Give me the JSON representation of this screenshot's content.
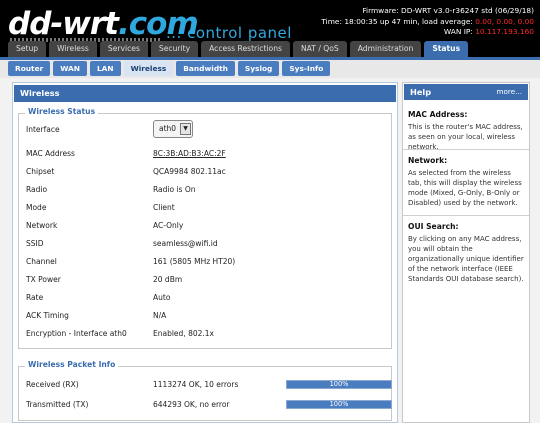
{
  "header": {
    "logo_main": "dd-wrt",
    "logo_dot": ".com",
    "logo_sub": "... control panel",
    "firmware_label": "Firmware: ",
    "firmware_value": "DD-WRT v3.0-r36247 std (06/29/18)",
    "time_label": "Time: ",
    "time_value": "18:00:35 up 47 min, load average: ",
    "load_value": "0.00, 0.00, 0.00",
    "wan_label": "WAN IP: ",
    "wan_value": "10.117.193.160"
  },
  "tabs": [
    "Setup",
    "Wireless",
    "Services",
    "Security",
    "Access Restrictions",
    "NAT / QoS",
    "Administration",
    "Status"
  ],
  "active_tab": "Status",
  "subtabs": [
    "Router",
    "WAN",
    "LAN",
    "Wireless",
    "Bandwidth",
    "Syslog",
    "Sys-Info"
  ],
  "active_subtab": "Wireless",
  "content": {
    "title": "Wireless",
    "status_legend": "Wireless Status",
    "interface_label": "Interface",
    "interface_value": "ath0",
    "rows": [
      {
        "label": "MAC Address",
        "value": "8C:3B:AD:B3:AC:2F"
      },
      {
        "label": "Chipset",
        "value": "QCA9984 802.11ac"
      },
      {
        "label": "Radio",
        "value": "Radio is On"
      },
      {
        "label": "Mode",
        "value": "Client"
      },
      {
        "label": "Network",
        "value": "AC-Only"
      },
      {
        "label": "SSID",
        "value": "seamless@wifi.id"
      },
      {
        "label": "Channel",
        "value": "161 (5805 MHz HT20)"
      },
      {
        "label": "TX Power",
        "value": "20 dBm"
      },
      {
        "label": "Rate",
        "value": "Auto"
      },
      {
        "label": "ACK Timing",
        "value": "N/A"
      },
      {
        "label": "Encryption - Interface ath0",
        "value": "Enabled, 802.1x"
      }
    ],
    "packet_legend": "Wireless Packet Info",
    "packets": [
      {
        "label": "Received (RX)",
        "value": "1113274 OK, 10 errors",
        "percent": 100,
        "percent_text": "100%"
      },
      {
        "label": "Transmitted (TX)",
        "value": "644293 OK, no error",
        "percent": 100,
        "percent_text": "100%"
      }
    ]
  },
  "help": {
    "title": "Help",
    "more": "more...",
    "sections": [
      {
        "heading": "MAC Address:",
        "text": "This is the router's MAC address, as seen on your local, wireless network."
      },
      {
        "heading": "Network:",
        "text": "As selected from the wireless tab, this will display the wireless mode (Mixed, G-Only, B-Only or Disabled) used by the network."
      },
      {
        "heading": "OUI Search:",
        "text": "By clicking on any MAC address, you will obtain the organizationally unique identifier of the network interface (IEEE Standards OUI database search)."
      }
    ]
  }
}
